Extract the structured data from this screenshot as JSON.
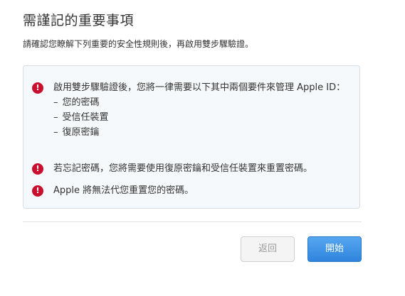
{
  "header": {
    "title": "需謹記的重要事項",
    "subtitle": "請確認您瞭解下列重要的安全性規則後，再啟用雙步驟驗證。"
  },
  "notices": [
    {
      "text": "啟用雙步驟驗證後，您將一律需要以下其中兩個要件來管理 Apple ID：",
      "sub_items": [
        "您的密碼",
        "受信任裝置",
        "復原密鑰"
      ]
    },
    {
      "text": "若忘記密碼，您將需要使用復原密鑰和受信任裝置來重置密碼。"
    },
    {
      "text": "Apple 將無法代您重置您的密碼。"
    }
  ],
  "warning_icon": {
    "name": "exclamation-icon",
    "glyph": "!",
    "color": "#c8102e"
  },
  "buttons": {
    "back_label": "返回",
    "start_label": "開始"
  },
  "colors": {
    "primary_button": "#3a8ee6",
    "notice_background": "#f6f9fb"
  }
}
